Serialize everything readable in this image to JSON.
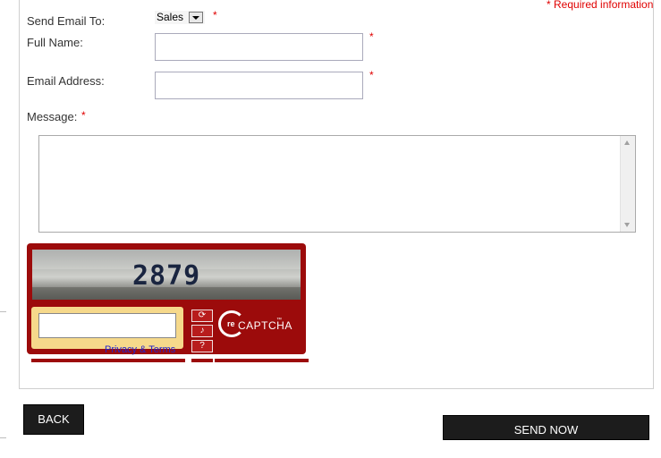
{
  "form": {
    "required_note": "* Required information",
    "required_marker": "*",
    "send_email_to": {
      "label": "Send Email To:",
      "selected": "Sales"
    },
    "full_name": {
      "label": "Full Name:",
      "value": ""
    },
    "email_address": {
      "label": "Email Address:",
      "value": ""
    },
    "message": {
      "label": "Message:",
      "value": ""
    }
  },
  "recaptcha": {
    "challenge_text": "2879",
    "privacy_label": "Privacy & Terms",
    "logo_prefix": "re",
    "logo_text": "CAPTCHA",
    "logo_tm": "™",
    "icons": [
      "refresh-icon",
      "audio-icon",
      "help-icon"
    ]
  },
  "buttons": {
    "back": "BACK",
    "send": "SEND NOW"
  },
  "colors": {
    "required": "#e00000",
    "recaptcha_brand": "#9c0b0b",
    "button_bg": "#1c1c1c"
  }
}
